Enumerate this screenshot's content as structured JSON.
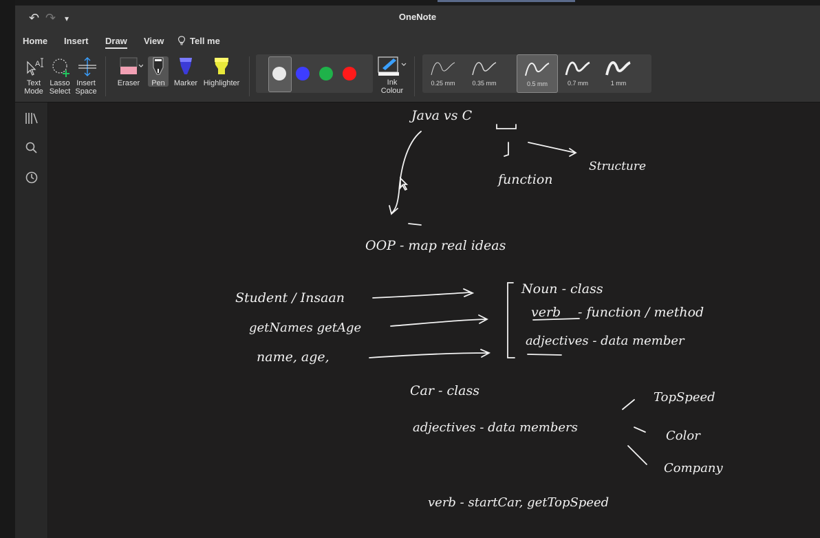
{
  "window": {
    "title": "OneNote",
    "quick_access": {
      "undo": "↶",
      "redo": "↷",
      "customize": "▾"
    }
  },
  "tabs": [
    {
      "label": "Home"
    },
    {
      "label": "Insert"
    },
    {
      "label": "Draw",
      "active": true
    },
    {
      "label": "View"
    },
    {
      "label": "Tell me"
    }
  ],
  "ribbon": {
    "text_mode": {
      "line1": "Text",
      "line2": "Mode"
    },
    "lasso_select": {
      "line1": "Lasso",
      "line2": "Select"
    },
    "insert_space": {
      "line1": "Insert",
      "line2": "Space"
    },
    "eraser": "Eraser",
    "pen": "Pen",
    "marker": "Marker",
    "highlighter": "Highlighter",
    "colors": [
      "#e8e8e8",
      "#3d3dff",
      "#1fb24a",
      "#ff1a1a"
    ],
    "ink_colour": {
      "line1": "Ink",
      "line2": "Colour"
    },
    "thicknesses": [
      {
        "label": "0.25 mm"
      },
      {
        "label": "0.35 mm"
      },
      {
        "label": "0.5 mm",
        "selected": true
      },
      {
        "label": "0.7 mm"
      },
      {
        "label": "1 mm"
      }
    ]
  },
  "sidebar": [
    "notebooks-icon",
    "search-icon",
    "recent-icon"
  ],
  "notes": {
    "java_vs_c": "Java vs C",
    "function": "function",
    "structure": "Structure",
    "oop": "OOP - map real ideas",
    "student": "Student / Insaan",
    "getnames": "getNames getAge",
    "name_age": "name, age,",
    "noun": "Noun - class",
    "verb": "verb",
    "verb_rest": "- function / method",
    "adjectives": "adjectives - data member",
    "car_class": "Car - class",
    "adjectives_members": "adjectives - data members",
    "topspeed": "TopSpeed",
    "color": "Color",
    "company": "Company",
    "verb_start": "verb - startCar, getTopSpeed"
  }
}
